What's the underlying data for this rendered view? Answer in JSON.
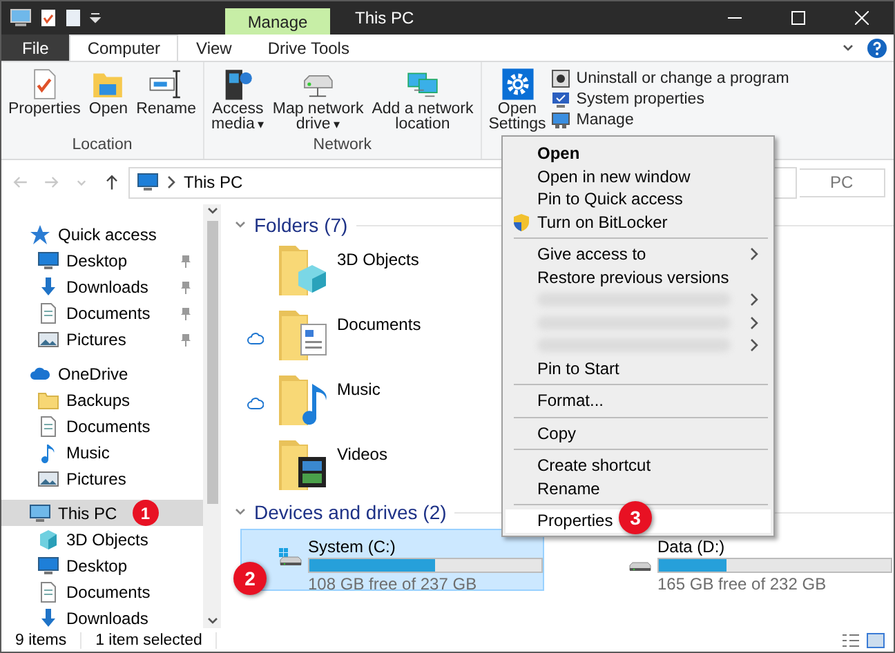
{
  "window": {
    "title": "This PC",
    "context_tab": "Manage"
  },
  "ribbon_tabs": [
    {
      "label": "File",
      "kind": "file",
      "selected": false
    },
    {
      "label": "Computer",
      "kind": "tab",
      "selected": true
    },
    {
      "label": "View",
      "kind": "tab",
      "selected": false
    },
    {
      "label": "Drive Tools",
      "kind": "tab",
      "selected": false
    }
  ],
  "ribbon_groups": [
    {
      "label": "Location",
      "buttons": [
        {
          "lines": [
            "Properties"
          ],
          "kind": "properties"
        },
        {
          "lines": [
            "Open"
          ],
          "kind": "folder"
        },
        {
          "lines": [
            "Rename"
          ],
          "kind": "rename"
        }
      ]
    },
    {
      "label": "Network",
      "buttons": [
        {
          "lines": [
            "Access",
            "media"
          ],
          "kind": "media",
          "dropdown_arrow": "▾"
        },
        {
          "lines": [
            "Map network",
            "drive"
          ],
          "kind": "netdrive",
          "dropdown_arrow": "▾"
        },
        {
          "lines": [
            "Add a network",
            "location"
          ],
          "kind": "netloc"
        }
      ]
    },
    {
      "buttons": [
        {
          "lines": [
            "Open",
            "Settings"
          ],
          "kind": "settings"
        }
      ],
      "small_buttons": [
        {
          "label": "Uninstall or change a program",
          "kind": "uninstall"
        },
        {
          "label": "System properties",
          "kind": "sysprops"
        },
        {
          "label": "Manage",
          "kind": "manage"
        }
      ]
    }
  ],
  "navigation": [
    {
      "kind": "back",
      "disabled": true
    },
    {
      "kind": "forward",
      "disabled": true
    },
    {
      "kind": "recent",
      "disabled": true
    },
    {
      "kind": "up",
      "disabled": false
    }
  ],
  "address": {
    "path": "This PC"
  },
  "search": {
    "placeholder": "PC"
  },
  "sidebar": {
    "items": [
      {
        "label": "Quick access",
        "kind": "star",
        "selected": false,
        "children": [
          {
            "label": "Desktop",
            "kind": "desktop",
            "pinned": true,
            "selected": false
          },
          {
            "label": "Downloads",
            "kind": "download",
            "pinned": true,
            "selected": false
          },
          {
            "label": "Documents",
            "kind": "document",
            "pinned": true,
            "selected": false
          },
          {
            "label": "Pictures",
            "kind": "pictures",
            "pinned": true,
            "selected": false
          }
        ]
      },
      {
        "label": "OneDrive",
        "kind": "cloud",
        "selected": false,
        "children": [
          {
            "label": "Backups",
            "kind": "folder",
            "pinned": false,
            "selected": false
          },
          {
            "label": "Documents",
            "kind": "document",
            "pinned": false,
            "selected": false
          },
          {
            "label": "Music",
            "kind": "music",
            "pinned": false,
            "selected": false
          },
          {
            "label": "Pictures",
            "kind": "pictures",
            "pinned": false,
            "selected": false
          }
        ]
      },
      {
        "label": "This PC",
        "kind": "pc",
        "selected": true,
        "badge": "1",
        "children": [
          {
            "label": "3D Objects",
            "kind": "cube",
            "pinned": false,
            "selected": false
          },
          {
            "label": "Desktop",
            "kind": "desktop",
            "pinned": false,
            "selected": false
          },
          {
            "label": "Documents",
            "kind": "document",
            "pinned": false,
            "selected": false
          },
          {
            "label": "Downloads",
            "kind": "download",
            "pinned": false,
            "selected": false
          }
        ]
      }
    ]
  },
  "sections": [
    {
      "title": "Folders (7)",
      "kind": "folders",
      "expanded": true,
      "items": [
        {
          "label": "3D Objects",
          "kind": "cube",
          "cloud": false
        },
        {
          "label": "Documents",
          "kind": "document",
          "cloud": true
        },
        {
          "label": "Music",
          "kind": "music",
          "cloud": true
        },
        {
          "label": "Videos",
          "kind": "video",
          "cloud": false
        }
      ]
    },
    {
      "title": "Devices and drives (2)",
      "kind": "drives",
      "expanded": true,
      "items": [
        {
          "name": "System (C:)",
          "kind": "system",
          "free": "108 GB free of 237 GB",
          "level": 0.54,
          "selected": true,
          "badge": "2"
        },
        {
          "name": "Data (D:)",
          "kind": "data",
          "free": "165 GB free of 232 GB",
          "level": 0.29,
          "selected": false
        }
      ]
    }
  ],
  "context_menu": {
    "items": [
      {
        "kind": "item",
        "label": "Open",
        "default": true,
        "submenu": false,
        "selected": false
      },
      {
        "kind": "item",
        "label": "Open in new window",
        "default": false,
        "submenu": false,
        "selected": false
      },
      {
        "kind": "item",
        "label": "Pin to Quick access",
        "default": false,
        "submenu": false,
        "selected": false
      },
      {
        "kind": "shield",
        "label": "Turn on BitLocker",
        "default": false,
        "submenu": false,
        "selected": false
      },
      {
        "kind": "separator"
      },
      {
        "kind": "item",
        "label": "Give access to",
        "default": false,
        "submenu": true,
        "selected": false
      },
      {
        "kind": "item",
        "label": "Restore previous versions",
        "default": false,
        "submenu": false,
        "selected": false
      },
      {
        "kind": "blurred",
        "submenu": true,
        "selected": false
      },
      {
        "kind": "blurred",
        "submenu": true,
        "selected": false
      },
      {
        "kind": "blurred",
        "submenu": true,
        "selected": false
      },
      {
        "kind": "item",
        "label": "Pin to Start",
        "default": false,
        "submenu": false,
        "selected": false
      },
      {
        "kind": "separator"
      },
      {
        "kind": "item",
        "label": "Format...",
        "default": false,
        "submenu": false,
        "selected": false
      },
      {
        "kind": "separator"
      },
      {
        "kind": "item",
        "label": "Copy",
        "default": false,
        "submenu": false,
        "selected": false
      },
      {
        "kind": "separator"
      },
      {
        "kind": "item",
        "label": "Create shortcut",
        "default": false,
        "submenu": false,
        "selected": false
      },
      {
        "kind": "item",
        "label": "Rename",
        "default": false,
        "submenu": false,
        "selected": false
      },
      {
        "kind": "separator"
      },
      {
        "kind": "item",
        "label": "Properties",
        "default": false,
        "submenu": false,
        "selected": true,
        "badge": "3"
      }
    ]
  },
  "status_bar": {
    "count": "9 items",
    "selection": "1 item selected"
  }
}
